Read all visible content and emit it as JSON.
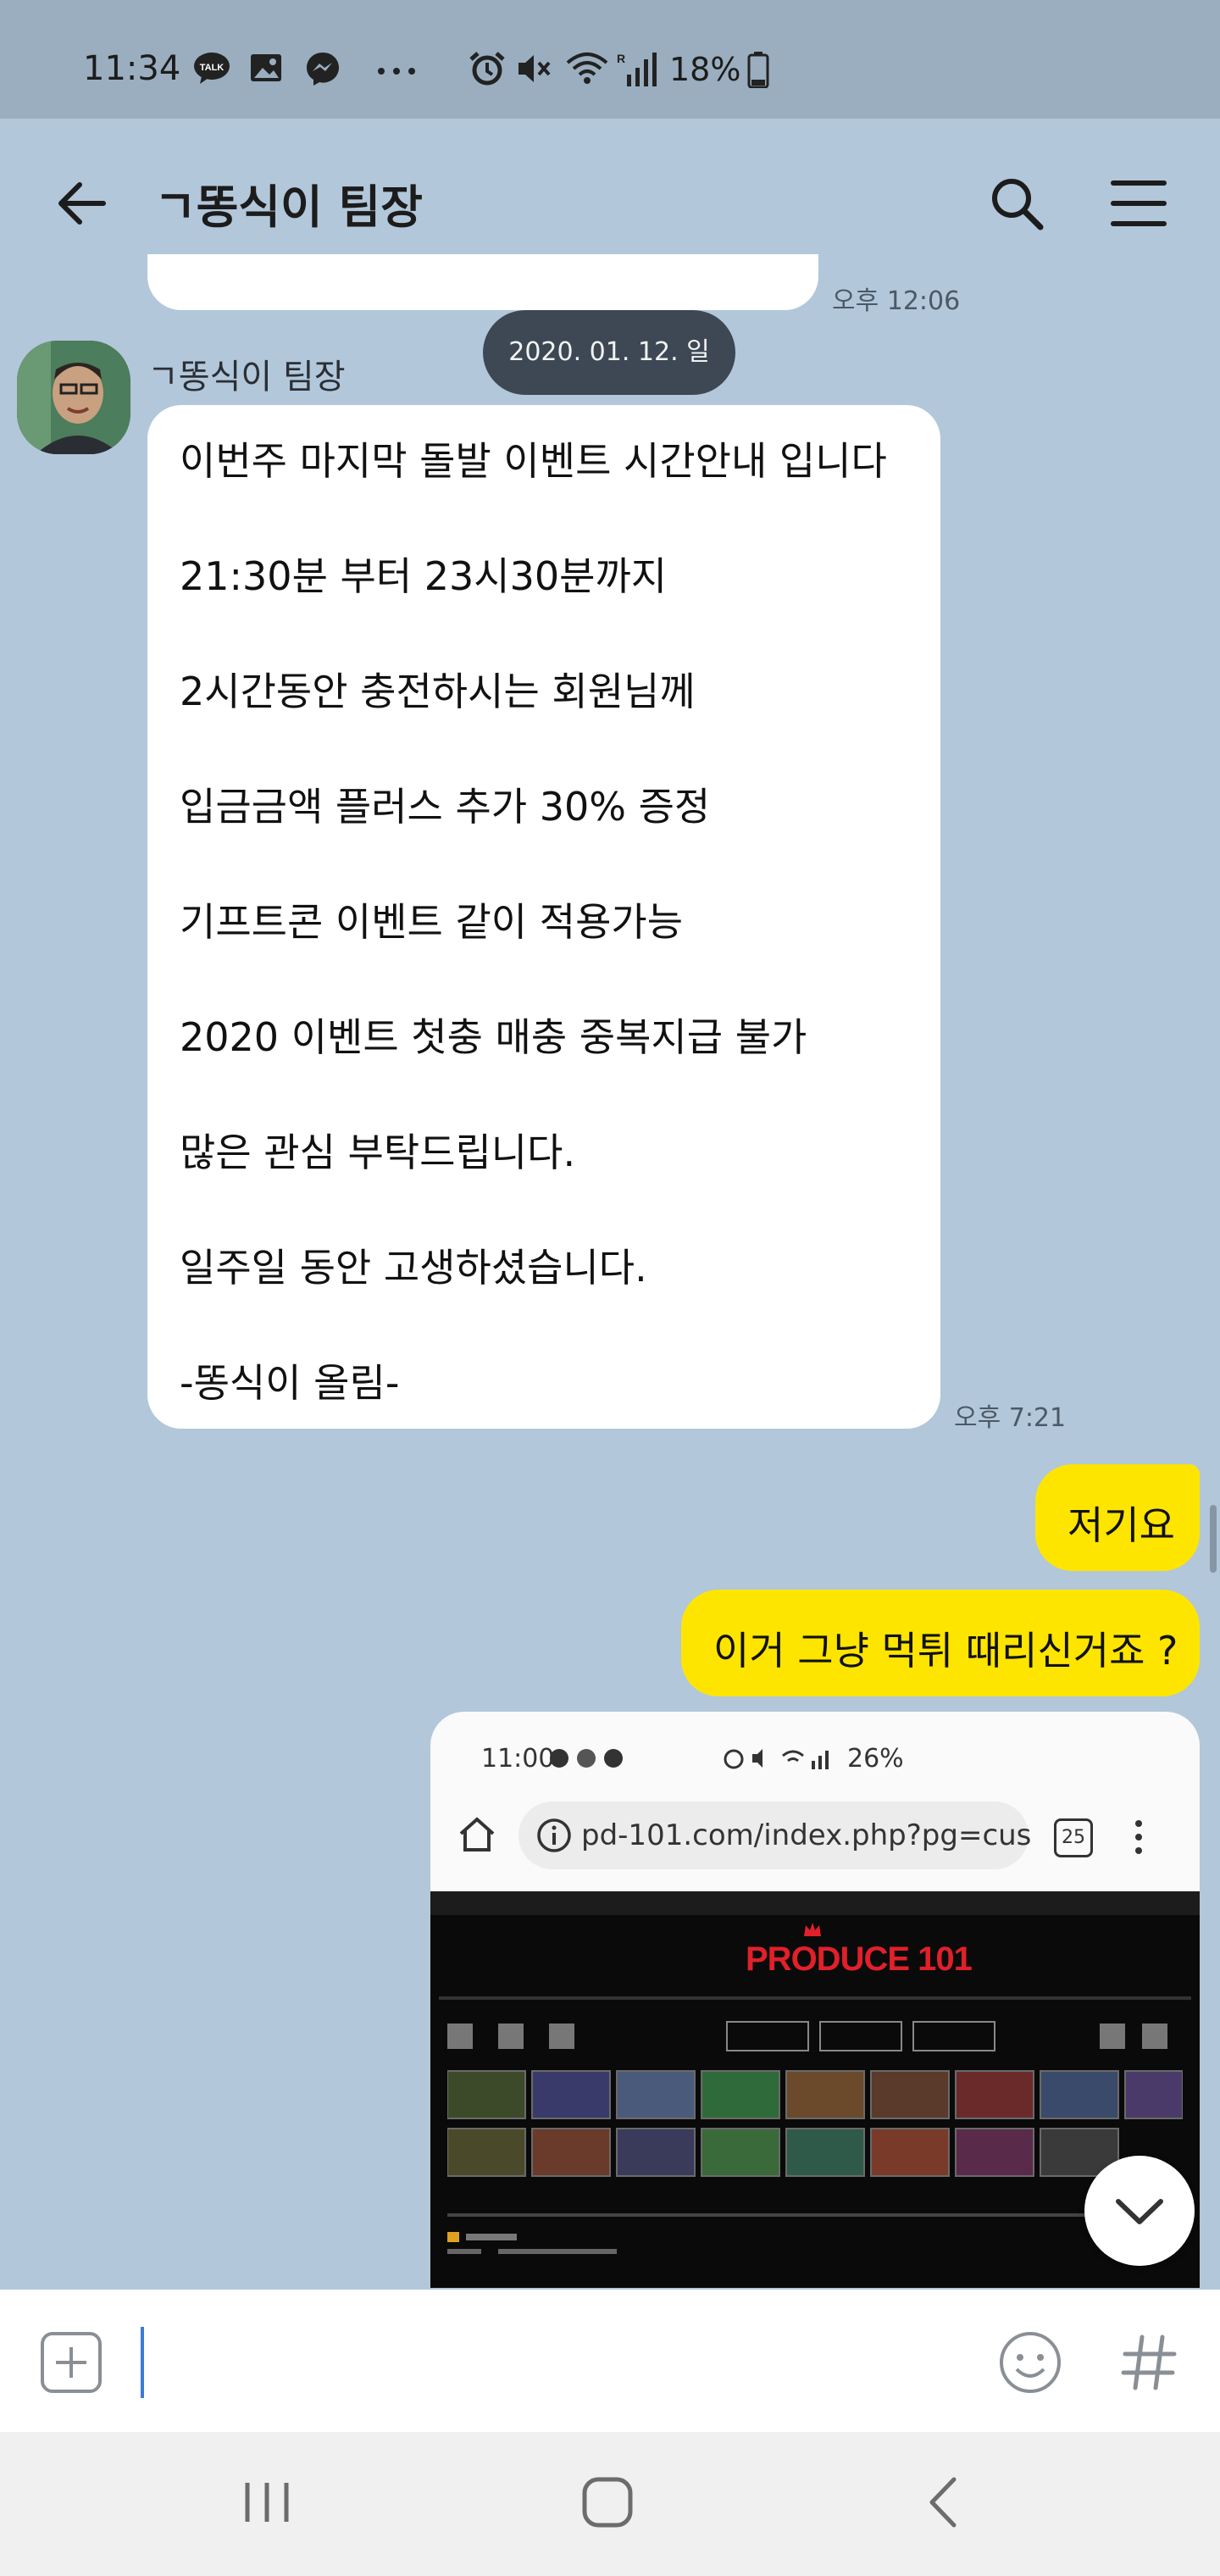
{
  "status_bar": {
    "time": "11:34",
    "battery_text": "18%",
    "icons": [
      "talk-icon",
      "image-icon",
      "messenger-icon",
      "more-dots-icon",
      "alarm-icon",
      "mute-icon",
      "wifi-icon",
      "signal-icon",
      "battery-icon"
    ],
    "talk_badge": "TALK",
    "signal_badge": "R"
  },
  "header": {
    "title": "ㄱ똥식이 팀장",
    "icons": [
      "back-arrow-icon",
      "search-icon",
      "menu-icon"
    ]
  },
  "chat": {
    "prev_message_time": "오후 12:06",
    "date_divider": "2020. 01. 12. 일",
    "sender_name": "ㄱ똥식이 팀장",
    "long_message": {
      "lines": [
        "이번주 마지막 돌발 이벤트 시간안내 입니다",
        "21:30분 부터 23시30분까지",
        "2시간동안 충전하시는 회원님께",
        "입금금액 플러스 추가 30% 증정",
        "기프트콘 이벤트 같이 적용가능",
        "2020 이벤트 첫충 매충 중복지급 불가",
        "많은 관심 부탁드립니다.",
        "일주일 동안 고생하셨습니다.",
        "-똥식이 올림-"
      ],
      "time": "오후 7:21"
    },
    "my_messages": [
      "저기요",
      "이거 그냥 먹튀 때리신거죠 ?"
    ]
  },
  "screenshot_thumb": {
    "status_time": "11:00",
    "status_battery": "26%",
    "url": "pd-101.com/index.php?pg=cus",
    "tab_count": "25",
    "site_logo": "PRODUCE 101",
    "colors": {
      "site_bg": "#0a0a0a",
      "logo": "#e0202a"
    }
  },
  "input_bar": {
    "icons": [
      "add-icon",
      "emoji-icon",
      "hashtag-icon"
    ]
  },
  "nav_bar": {
    "icons": [
      "recent-apps-icon",
      "home-icon",
      "back-icon"
    ]
  },
  "colors": {
    "chat_bg": "#b2c7da",
    "status_bg": "#9aaebf",
    "my_bubble": "#fee500",
    "their_bubble": "#ffffff",
    "date_pill": "#3d4854"
  }
}
